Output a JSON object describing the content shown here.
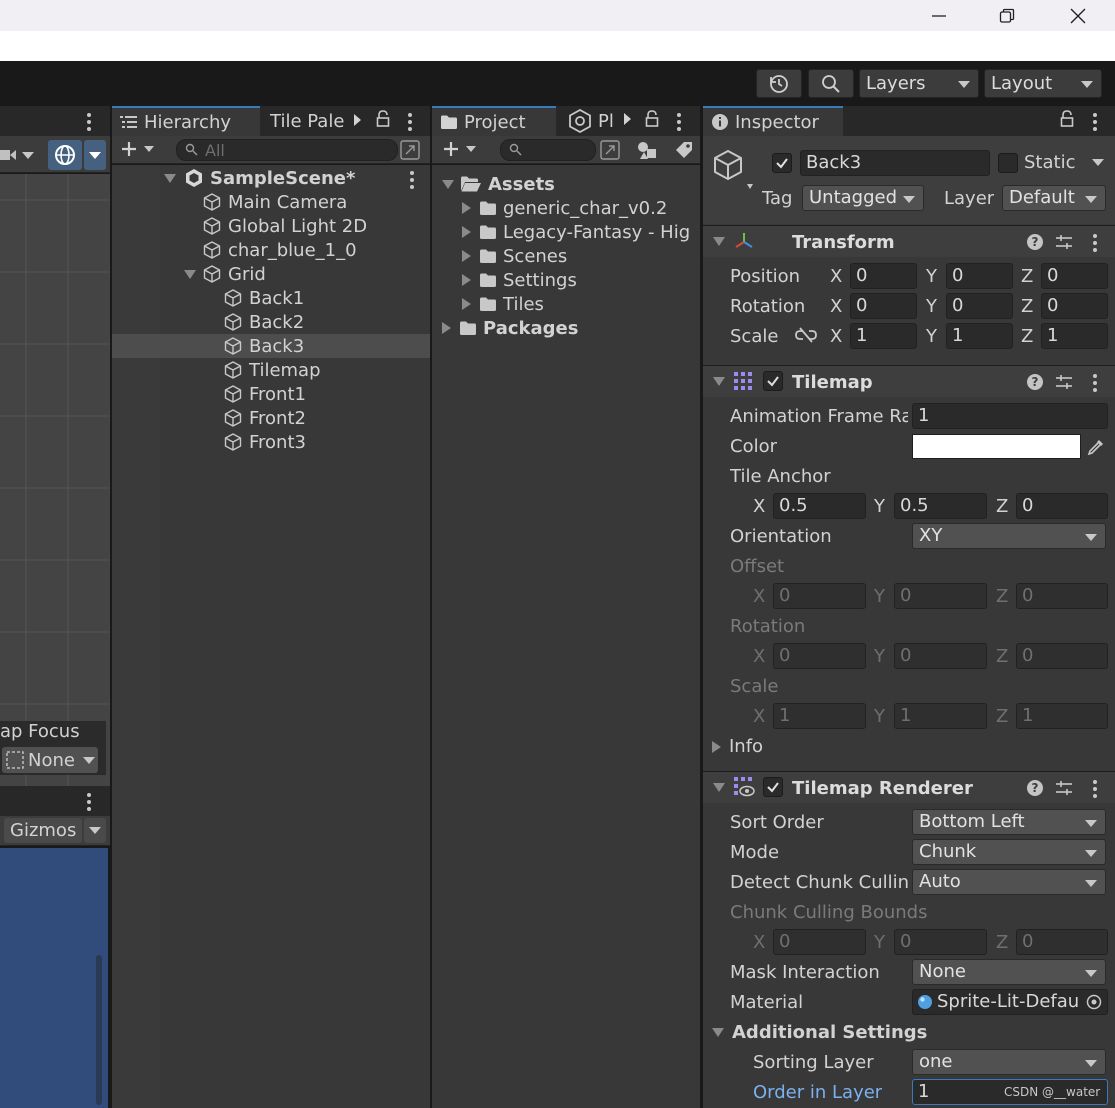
{
  "window": {
    "minimize_icon": "minimize-icon",
    "maximize_icon": "restore-icon",
    "close_icon": "close-icon"
  },
  "toolbar": {
    "layers_label": "Layers",
    "layout_label": "Layout"
  },
  "scene": {
    "overlay_title": "ap Focus",
    "overlay_value": "None",
    "gizmos_label": "Gizmos"
  },
  "hierarchy": {
    "tab_hierarchy": "Hierarchy",
    "tab_palette": "Tile Pale",
    "search_placeholder": "All",
    "scene_name": "SampleScene*",
    "items": [
      "Main Camera",
      "Global Light 2D",
      "char_blue_1_0",
      "Grid",
      "Back1",
      "Back2",
      "Back3",
      "Tilemap",
      "Front1",
      "Front2",
      "Front3"
    ]
  },
  "project": {
    "tab_project": "Project",
    "tab_pl": "Pl",
    "assets_label": "Assets",
    "folders": [
      "generic_char_v0.2",
      "Legacy-Fantasy - Hig",
      "Scenes",
      "Settings",
      "Tiles"
    ],
    "packages_label": "Packages"
  },
  "inspector": {
    "tab_label": "Inspector",
    "object_name": "Back3",
    "static_label": "Static",
    "tag_label": "Tag",
    "tag_value": "Untagged",
    "layer_label": "Layer",
    "layer_value": "Default",
    "transform": {
      "title": "Transform",
      "position_label": "Position",
      "rotation_label": "Rotation",
      "scale_label": "Scale",
      "position": [
        "0",
        "0",
        "0"
      ],
      "rotation": [
        "0",
        "0",
        "0"
      ],
      "scale": [
        "1",
        "1",
        "1"
      ]
    },
    "tilemap": {
      "title": "Tilemap",
      "anim_frame_label": "Animation Frame Rat",
      "anim_frame_value": "1",
      "color_label": "Color",
      "color_value": "#ffffff",
      "tile_anchor_label": "Tile Anchor",
      "tile_anchor": [
        "0.5",
        "0.5",
        "0"
      ],
      "orientation_label": "Orientation",
      "orientation_value": "XY",
      "offset_label": "Offset",
      "offset": [
        "0",
        "0",
        "0"
      ],
      "rotation_label": "Rotation",
      "rotation": [
        "0",
        "0",
        "0"
      ],
      "scale_label": "Scale",
      "scale": [
        "1",
        "1",
        "1"
      ],
      "info_label": "Info"
    },
    "renderer": {
      "title": "Tilemap Renderer",
      "sort_order_label": "Sort Order",
      "sort_order_value": "Bottom Left",
      "mode_label": "Mode",
      "mode_value": "Chunk",
      "detect_label": "Detect Chunk Cullin",
      "detect_value": "Auto",
      "bounds_label": "Chunk Culling Bounds",
      "bounds": [
        "0",
        "0",
        "0"
      ],
      "mask_label": "Mask Interaction",
      "mask_value": "None",
      "material_label": "Material",
      "material_value": "Sprite-Lit-Defau",
      "additional_label": "Additional Settings",
      "sorting_layer_label": "Sorting Layer",
      "sorting_layer_value": "one",
      "order_label": "Order in Layer",
      "order_value": "1"
    },
    "axis_labels": [
      "X",
      "Y",
      "Z"
    ]
  },
  "watermark": "CSDN @__water",
  "colors": {
    "accent": "#3a79bb",
    "panel": "#383838",
    "scene_blue": "#314c7a"
  }
}
